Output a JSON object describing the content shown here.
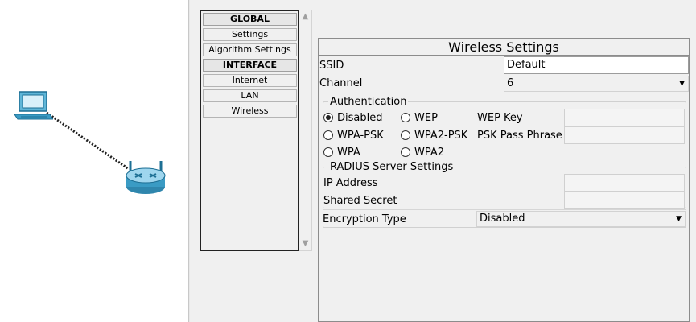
{
  "navigation": {
    "items": [
      {
        "label": "GLOBAL",
        "header": true
      },
      {
        "label": "Settings",
        "header": false
      },
      {
        "label": "Algorithm Settings",
        "header": false
      },
      {
        "label": "INTERFACE",
        "header": true
      },
      {
        "label": "Internet",
        "header": false
      },
      {
        "label": "LAN",
        "header": false
      },
      {
        "label": "Wireless",
        "header": false
      }
    ],
    "scroll_up_glyph": "▲",
    "scroll_down_glyph": "▼"
  },
  "workspace": {
    "devices": [
      {
        "type": "pc",
        "icon": "pc-icon"
      },
      {
        "type": "wireless-router",
        "icon": "wireless-router-icon"
      }
    ],
    "colors": {
      "device": "#3a9bc4",
      "link": "#222222"
    }
  },
  "wireless_settings": {
    "title": "Wireless Settings",
    "ssid": {
      "label": "SSID",
      "value": "Default"
    },
    "channel": {
      "label": "Channel",
      "value": "6"
    },
    "authentication": {
      "legend": "Authentication",
      "options": [
        {
          "label": "Disabled",
          "checked": true
        },
        {
          "label": "WEP",
          "checked": false
        },
        {
          "label": "WPA-PSK",
          "checked": false
        },
        {
          "label": "WPA2-PSK",
          "checked": false
        },
        {
          "label": "WPA",
          "checked": false
        },
        {
          "label": "WPA2",
          "checked": false
        }
      ],
      "wep_key_label": "WEP Key",
      "wep_key_value": "",
      "psk_label": "PSK Pass Phrase",
      "psk_value": "",
      "radius": {
        "legend": "RADIUS Server Settings",
        "ip_label": "IP Address",
        "ip_value": "",
        "secret_label": "Shared Secret",
        "secret_value": ""
      }
    },
    "encryption": {
      "label": "Encryption Type",
      "value": "Disabled"
    },
    "dropdown_glyph": "▼"
  }
}
